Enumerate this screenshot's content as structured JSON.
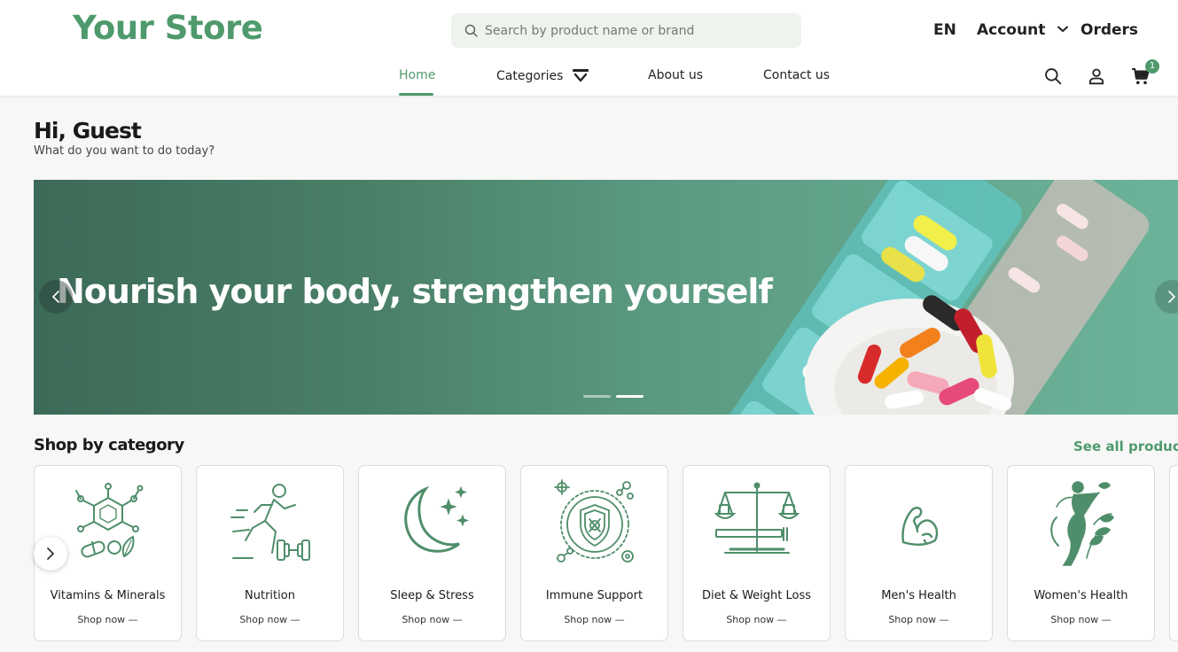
{
  "header": {
    "logo": "Your Store",
    "search_placeholder": "Search by product name or brand",
    "language": "EN",
    "account_label": "Account",
    "orders_label": "Orders",
    "cart_count": "1",
    "nav": [
      {
        "label": "Home",
        "active": true
      },
      {
        "label": "Categories"
      },
      {
        "label": "About us"
      },
      {
        "label": "Contact us"
      }
    ]
  },
  "greeting": {
    "title": "Hi, Guest",
    "subtitle": "What do you want to do today?"
  },
  "banner": {
    "title": "Nourish your body, strengthen yourself",
    "active_slide": 2,
    "slide_count": 2
  },
  "categories_section": {
    "title": "Shop by category",
    "see_all": "See all products",
    "shop_label": "Shop now —",
    "items": [
      {
        "name": "Vitamins & Minerals",
        "icon": "molecule-icon"
      },
      {
        "name": "Nutrition",
        "icon": "runner-dumbbell-icon"
      },
      {
        "name": "Sleep & Stress",
        "icon": "moon-stars-icon"
      },
      {
        "name": "Immune Support",
        "icon": "shield-virus-icon"
      },
      {
        "name": "Diet & Weight Loss",
        "icon": "scale-icon"
      },
      {
        "name": "Men's Health",
        "icon": "flexed-arm-icon"
      },
      {
        "name": "Women's Health",
        "icon": "woman-leaf-icon"
      }
    ]
  },
  "colors": {
    "brand": "#4f9a6d",
    "banner_start": "#3c6a58",
    "banner_end": "#6cb39a"
  }
}
